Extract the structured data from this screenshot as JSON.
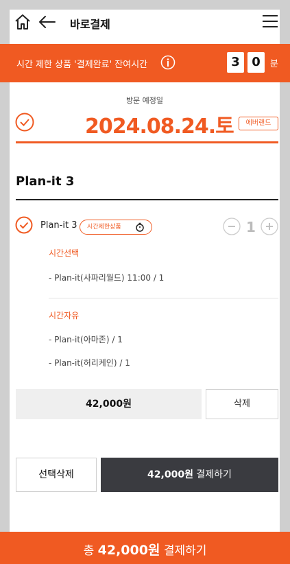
{
  "header": {
    "title": "바로결제",
    "icons": [
      "home-icon",
      "back-arrow-icon",
      "hamburger-menu-icon"
    ]
  },
  "timer": {
    "text": "시간 제한 상품 '결제완료' 잔여시간",
    "digits": [
      "3",
      "0"
    ],
    "unit": "분",
    "info_icon": "info-icon"
  },
  "visit": {
    "label": "방문 예정일",
    "date": "2024.08.24.토",
    "brand": "에버랜드"
  },
  "product": {
    "title": "Plan-it 3",
    "item": {
      "name": "Plan-it 3",
      "badge": "시간제한상품",
      "quantity": "1"
    },
    "sections": [
      {
        "title": "시간선택",
        "options": [
          "- Plan-it(사파리월드) 11:00 / 1"
        ]
      },
      {
        "title": "시간자유",
        "options": [
          "- Plan-it(아마존) / 1",
          "- Plan-it(허리케인) / 1"
        ]
      }
    ],
    "price": "42,000원",
    "delete_label": "삭제"
  },
  "actions": {
    "select_delete": "선택삭제",
    "pay_amount": "42,000원",
    "pay_label": "결제하기"
  },
  "bottom_bar": {
    "prefix": "총",
    "amount": "42,000원",
    "suffix": "결제하기"
  },
  "colors": {
    "accent": "#f05a22",
    "dark_button": "#3a3b40"
  }
}
